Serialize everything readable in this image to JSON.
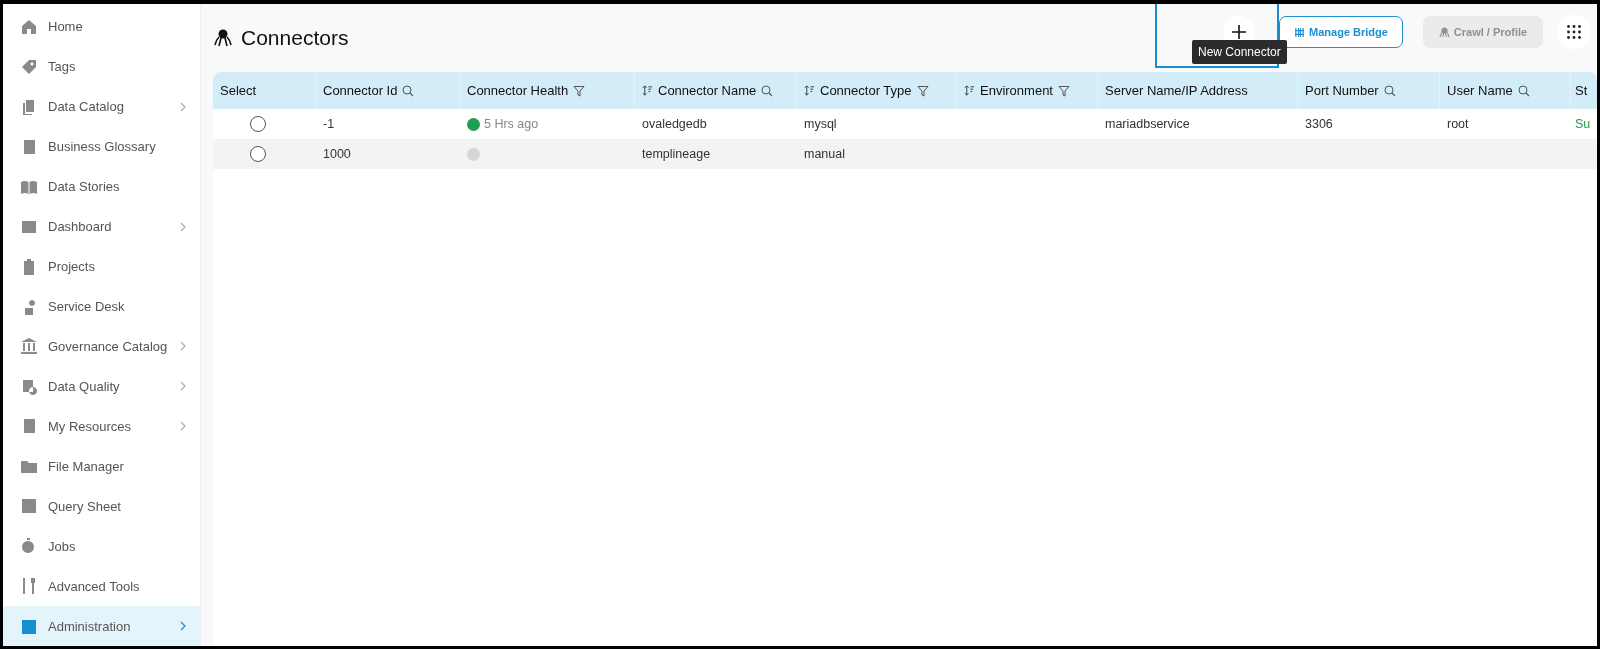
{
  "sidebar": {
    "items": [
      {
        "label": "Home",
        "expandable": false,
        "selected": false
      },
      {
        "label": "Tags",
        "expandable": false,
        "selected": false
      },
      {
        "label": "Data Catalog",
        "expandable": true,
        "selected": false
      },
      {
        "label": "Business Glossary",
        "expandable": false,
        "selected": false
      },
      {
        "label": "Data Stories",
        "expandable": false,
        "selected": false
      },
      {
        "label": "Dashboard",
        "expandable": true,
        "selected": false
      },
      {
        "label": "Projects",
        "expandable": false,
        "selected": false
      },
      {
        "label": "Service Desk",
        "expandable": false,
        "selected": false
      },
      {
        "label": "Governance Catalog",
        "expandable": true,
        "selected": false
      },
      {
        "label": "Data Quality",
        "expandable": true,
        "selected": false
      },
      {
        "label": "My Resources",
        "expandable": true,
        "selected": false
      },
      {
        "label": "File Manager",
        "expandable": false,
        "selected": false
      },
      {
        "label": "Query Sheet",
        "expandable": false,
        "selected": false
      },
      {
        "label": "Jobs",
        "expandable": false,
        "selected": false
      },
      {
        "label": "Advanced Tools",
        "expandable": false,
        "selected": false
      },
      {
        "label": "Administration",
        "expandable": true,
        "selected": true
      }
    ]
  },
  "page": {
    "title": "Connectors"
  },
  "toolbar": {
    "new_connector": {
      "tooltip": "New Connector",
      "highlighted": true
    },
    "buttons": [
      {
        "label": "Manage Bridge",
        "disabled": false
      },
      {
        "label": "Crawl / Profile",
        "disabled": true
      }
    ]
  },
  "table": {
    "columns": [
      {
        "label": "Select",
        "sortable": false,
        "searchable": false,
        "filterable": false
      },
      {
        "label": "Connector Id",
        "sortable": false,
        "searchable": true,
        "filterable": false
      },
      {
        "label": "Connector Health",
        "sortable": false,
        "searchable": false,
        "filterable": true
      },
      {
        "label": "Connector Name",
        "sortable": true,
        "searchable": true,
        "filterable": false
      },
      {
        "label": "Connector Type",
        "sortable": true,
        "searchable": false,
        "filterable": true
      },
      {
        "label": "Environment",
        "sortable": true,
        "searchable": false,
        "filterable": true
      },
      {
        "label": "Server Name/IP Address",
        "sortable": false,
        "searchable": false,
        "filterable": false
      },
      {
        "label": "Port Number",
        "sortable": false,
        "searchable": true,
        "filterable": false
      },
      {
        "label": "User Name",
        "sortable": false,
        "searchable": true,
        "filterable": false
      },
      {
        "label": "St"
      }
    ],
    "rows": [
      {
        "selected": false,
        "connector_id": "-1",
        "health": {
          "color": "#1e9e55",
          "text": "5 Hrs ago"
        },
        "connector_name": "ovaledgedb",
        "connector_type": "mysql",
        "server": "mariadbservice",
        "port": "3306",
        "user": "root",
        "column_10": "Su"
      },
      {
        "selected": false,
        "connector_id": "1000",
        "health": {
          "color": "#d6d6d6"
        },
        "connector_name": "templineage",
        "connector_type": "manual"
      }
    ]
  }
}
